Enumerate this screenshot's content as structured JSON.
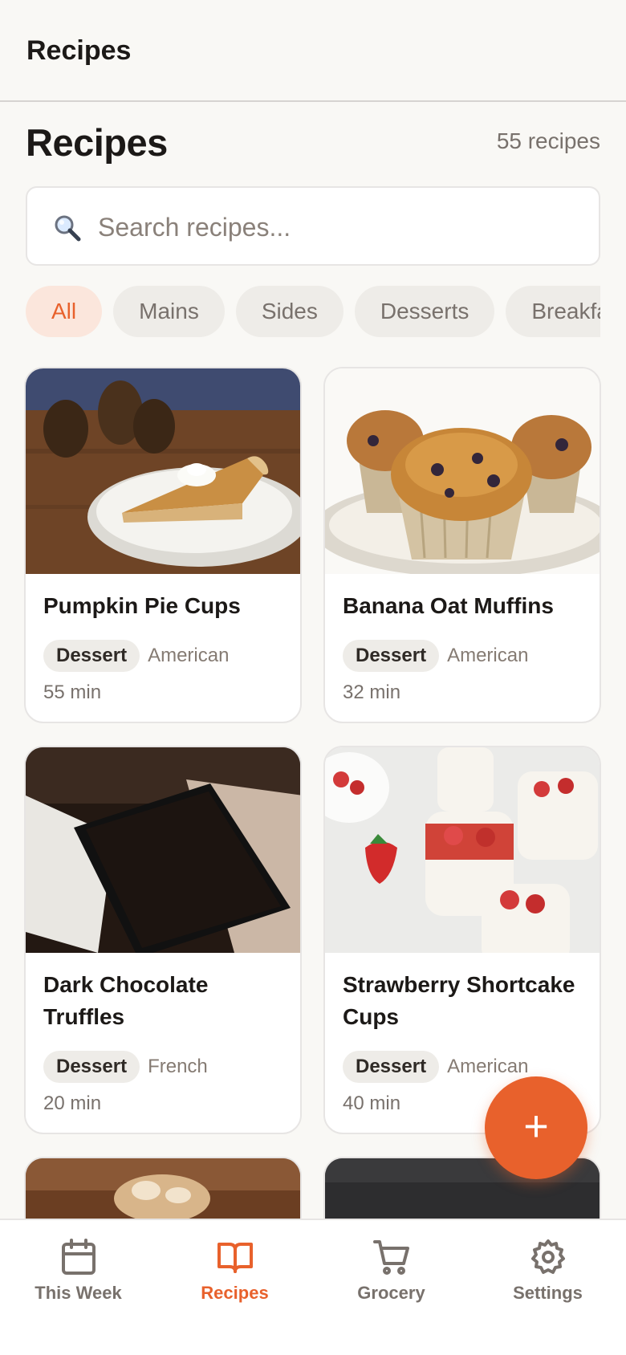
{
  "app_bar": {
    "title": "Recipes"
  },
  "page": {
    "heading": "Recipes",
    "count": "55 recipes"
  },
  "search": {
    "placeholder": "Search recipes...",
    "value": ""
  },
  "filters": [
    {
      "label": "All",
      "active": true
    },
    {
      "label": "Mains",
      "active": false
    },
    {
      "label": "Sides",
      "active": false
    },
    {
      "label": "Desserts",
      "active": false
    },
    {
      "label": "Breakfast",
      "active": false
    }
  ],
  "recipes": [
    {
      "name": "Pumpkin Pie Cups",
      "tag": "Dessert",
      "cuisine": "American",
      "time": "55 min",
      "image": "pumpkin-pie-slice"
    },
    {
      "name": "Banana Oat Muffins",
      "tag": "Dessert",
      "cuisine": "American",
      "time": "32 min",
      "image": "blueberry-muffins"
    },
    {
      "name": "Dark Chocolate Truffles",
      "tag": "Dessert",
      "cuisine": "French",
      "time": "20 min",
      "image": "chocolate-box"
    },
    {
      "name": "Strawberry Shortcake Cups",
      "tag": "Dessert",
      "cuisine": "American",
      "time": "40 min",
      "image": "strawberry-cups"
    },
    {
      "image": "dessert-partial"
    },
    {
      "image": "dark-partial"
    }
  ],
  "fab": {
    "label": "+",
    "icon": "plus-icon"
  },
  "tab_bar": [
    {
      "label": "This Week",
      "icon": "calendar-icon",
      "active": false
    },
    {
      "label": "Recipes",
      "icon": "book-icon",
      "active": true
    },
    {
      "label": "Grocery",
      "icon": "cart-icon",
      "active": false
    },
    {
      "label": "Settings",
      "icon": "gear-icon",
      "active": false
    }
  ],
  "colors": {
    "accent": "#e8612c",
    "background": "#f9f8f5",
    "text": "#1c1917",
    "muted": "#78716c"
  }
}
